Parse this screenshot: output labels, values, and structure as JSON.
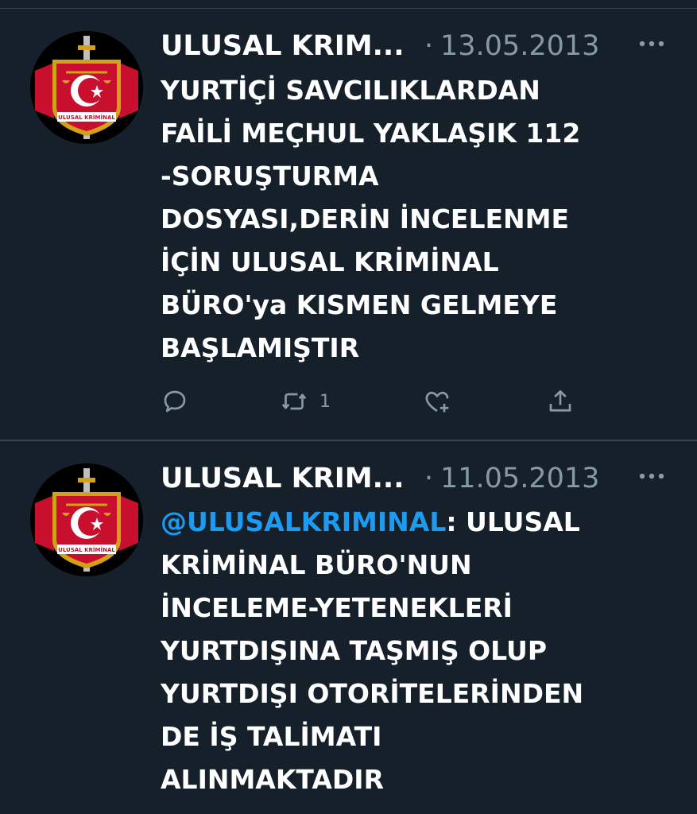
{
  "colors": {
    "background": "#15202b",
    "text": "#ffffff",
    "secondary_text": "#8899a6",
    "mention": "#1d9bf0",
    "divider": "#38444d"
  },
  "tweets": [
    {
      "author_name": "ULUSAL KRIM...",
      "separator": "·",
      "date": "13.05.2013",
      "more_icon": "more-horizontal-icon",
      "avatar_text": "ULUSAL KRİMİNAL",
      "lines": [
        "YURTİÇİ SAVCILIKLARDAN",
        "FAİLİ MEÇHUL YAKLAŞIK 112",
        "-SORUŞTURMA",
        "DOSYASI,DERİN İNCELENME",
        "İÇİN ULUSAL KRİMİNAL",
        "BÜRO'ya KISMEN GELMEYE",
        "BAŞLAMIŞTIR"
      ],
      "actions": {
        "reply_icon": "reply-icon",
        "retweet_icon": "retweet-icon",
        "retweet_count": "1",
        "like_icon": "like-icon",
        "share_icon": "share-icon"
      }
    },
    {
      "author_name": "ULUSAL KRIM...",
      "separator": "·",
      "date": "11.05.2013",
      "more_icon": "more-horizontal-icon",
      "avatar_text": "ULUSAL KRİMİNAL",
      "mention": "@ULUSALKRIMINAL",
      "mention_suffix": ": ULUSAL",
      "lines": [
        "KRİMİNAL BÜRO'NUN",
        "İNCELEME-YETENEKLERİ",
        "YURTDIŞINA TAŞMIŞ OLUP",
        "YURTDIŞI OTORİTELERİNDEN",
        "DE İŞ TALİMATI",
        "ALINMAKTADIR"
      ]
    }
  ]
}
